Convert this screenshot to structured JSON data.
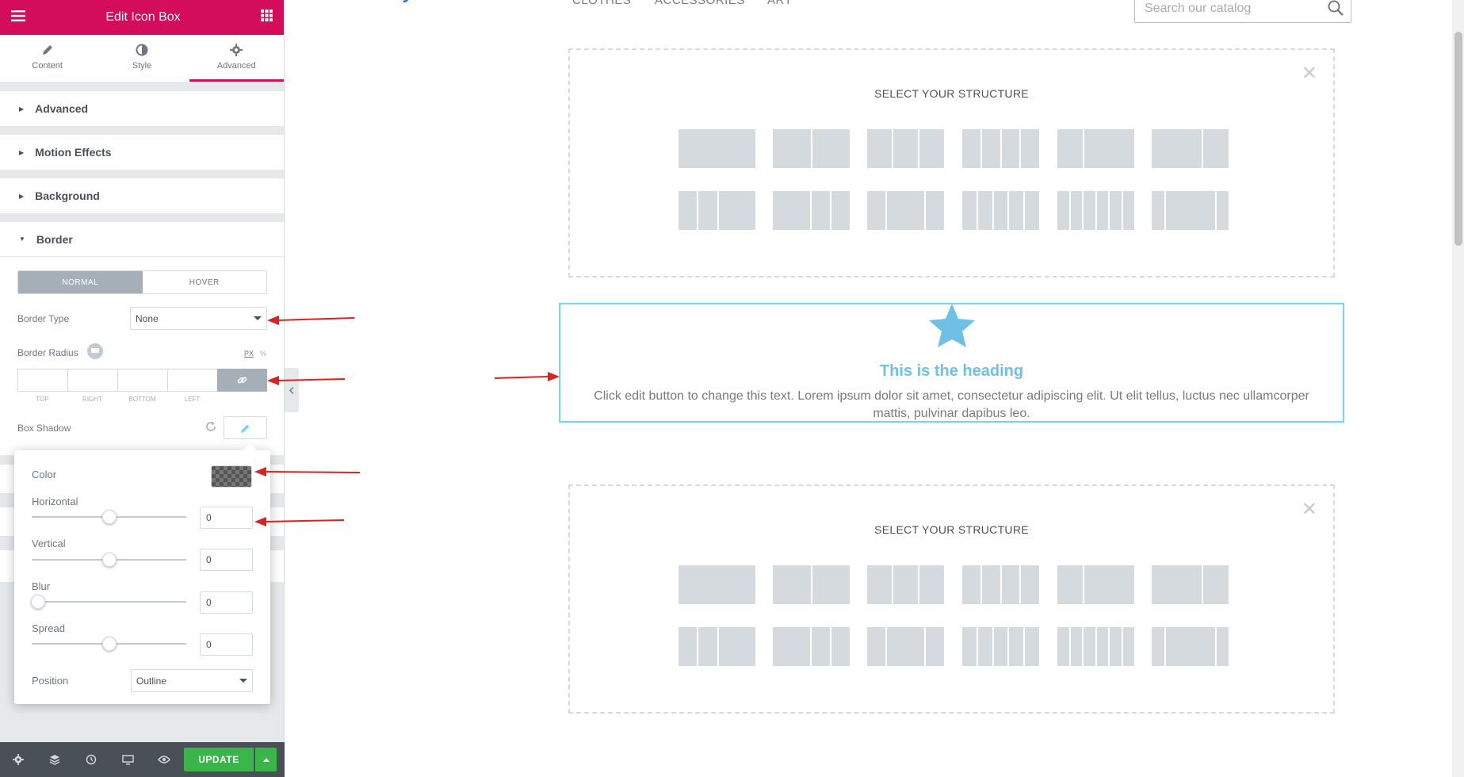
{
  "panel": {
    "title": "Edit Icon Box",
    "tabs": [
      {
        "label": "Content"
      },
      {
        "label": "Style"
      },
      {
        "label": "Advanced"
      }
    ],
    "sections": [
      "Advanced",
      "Motion Effects",
      "Background",
      "Border"
    ],
    "border": {
      "normal_label": "NORMAL",
      "hover_label": "HOVER",
      "border_type_label": "Border Type",
      "border_type_value": "None",
      "border_radius_label": "Border Radius",
      "unit_px": "PX",
      "unit_pct": "%",
      "dim_labels": [
        "TOP",
        "RIGHT",
        "BOTTOM",
        "LEFT"
      ],
      "box_shadow_label": "Box Shadow"
    },
    "shadow": {
      "color_label": "Color",
      "horizontal_label": "Horizontal",
      "horizontal_value": "0",
      "vertical_label": "Vertical",
      "vertical_value": "0",
      "blur_label": "Blur",
      "blur_value": "0",
      "spread_label": "Spread",
      "spread_value": "0",
      "position_label": "Position",
      "position_value": "Outline"
    },
    "footer": {
      "update_label": "UPDATE"
    },
    "accent_color": "#d30c5c"
  },
  "site": {
    "nav": [
      "CLOTHES",
      "ACCESSORIES",
      "ART"
    ],
    "search_placeholder": "Search our catalog"
  },
  "preview": {
    "structure_title": "SELECT YOUR STRUCTURE",
    "iconbox_heading": "This is the heading",
    "iconbox_text": "Click edit button to change this text. Lorem ipsum dolor sit amet, consectetur adipiscing elit. Ut elit tellus, luctus nec ullamcorper mattis, pulvinar dapibus leo."
  }
}
